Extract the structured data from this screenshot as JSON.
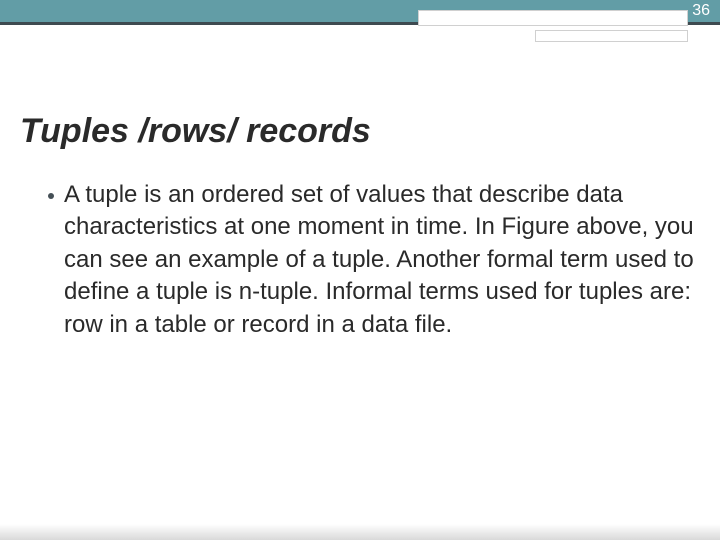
{
  "page_number": "36",
  "title": "Tuples /rows/ records",
  "body": "A tuple is an ordered set of values that describe data characteristics at one moment in time. In Figure  above, you can see an example of a tuple. Another formal term used to define a tuple is n-tuple. Informal terms used for tuples are: row in a table or record in a data file."
}
